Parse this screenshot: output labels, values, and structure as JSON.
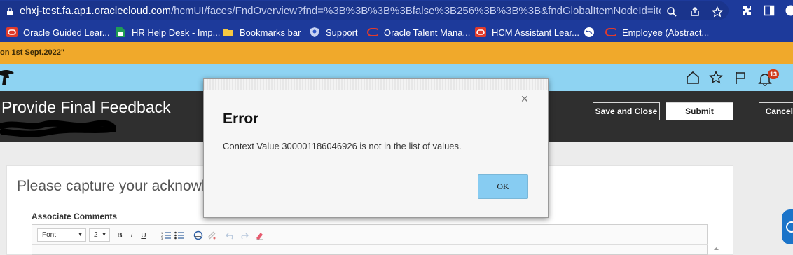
{
  "browser": {
    "url_host": "ehxj-test.fa.ap1.oraclecloud.com",
    "url_path": "/hcmUI/faces/FndOverview?fnd=%3B%3B%3B%3Bfalse%3B256%3B%3B%3B&fndGlobalItemNodeId=itemNode..."
  },
  "bookmarks": [
    {
      "label": "Oracle Guided Lear...",
      "icon": "oracle-icon"
    },
    {
      "label": "HR Help Desk - Imp...",
      "icon": "sheet-icon"
    },
    {
      "label": "Bookmarks bar",
      "icon": "folder-icon"
    },
    {
      "label": "Support",
      "icon": "support-icon"
    },
    {
      "label": "Oracle Talent Mana...",
      "icon": "oracle-ring-icon"
    },
    {
      "label": "HCM Assistant Lear...",
      "icon": "oracle-icon"
    },
    {
      "label": "Employee (Abstract...",
      "icon": "oracle-ring-icon"
    }
  ],
  "banner": {
    "text": "on 1st Sept.2022\""
  },
  "header": {
    "notification_count": "13"
  },
  "page": {
    "title": "Provide Final Feedback",
    "buttons": {
      "save_close": "Save and Close",
      "submit": "Submit",
      "cancel": "Cancel"
    }
  },
  "content": {
    "heading": "Please capture your acknowled",
    "field_label": "Associate Comments",
    "editor": {
      "font": "Font",
      "size": "2"
    }
  },
  "dialog": {
    "title": "Error",
    "message": "Context Value 300001186046926 is not in the list of values.",
    "ok_label": "OK"
  },
  "colors": {
    "chrome": "#1d3a9b",
    "banner": "#f0a92b",
    "appbar": "#8ed3f2",
    "titlebar": "#2f2f2f",
    "ok": "#87ccf2"
  }
}
